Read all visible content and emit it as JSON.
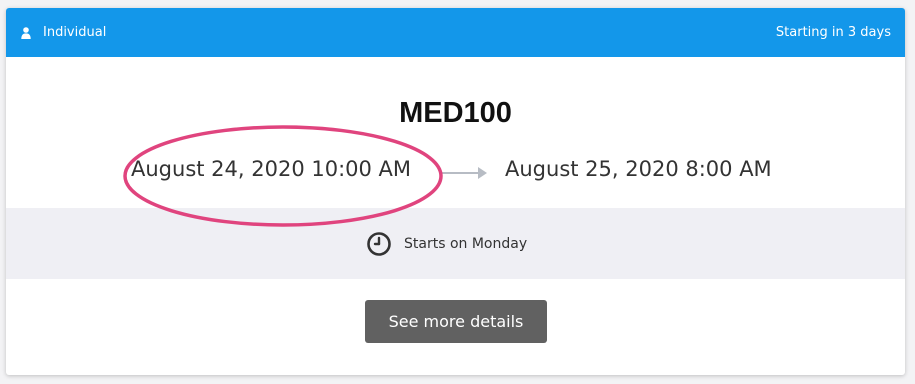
{
  "header": {
    "type_label": "Individual",
    "type_icon": "user-icon",
    "countdown": "Starting in 3 days",
    "color": "#1397ea"
  },
  "event": {
    "title": "MED100",
    "start": "August 24, 2020 10:00 AM",
    "end": "August 25, 2020 8:00 AM",
    "arrow_icon": "arrow-right-icon",
    "highlight_color": "#e0447e"
  },
  "status": {
    "icon": "clock-icon",
    "text": "Starts on Monday"
  },
  "actions": {
    "details_label": "See more details"
  }
}
